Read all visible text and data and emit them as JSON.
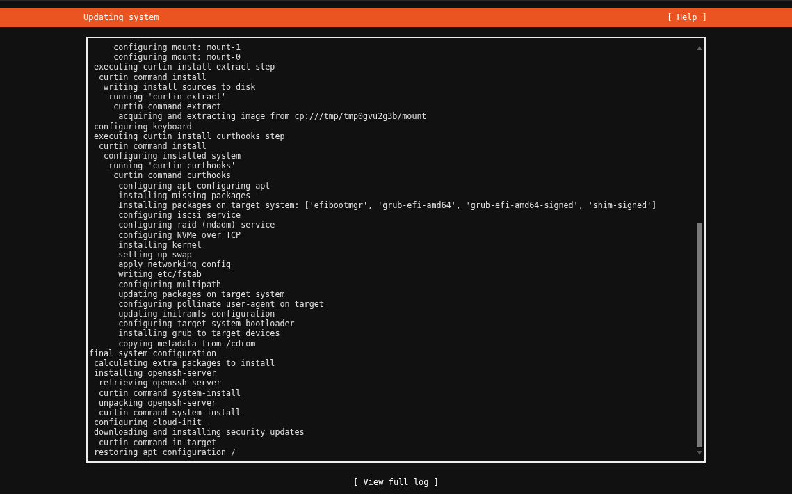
{
  "header": {
    "title": "Updating system",
    "help_button": "[ Help ]"
  },
  "log": {
    "lines": [
      "     configuring mount: mount-1",
      "     configuring mount: mount-0",
      " executing curtin install extract step",
      "  curtin command install",
      "   writing install sources to disk",
      "    running 'curtin extract'",
      "     curtin command extract",
      "      acquiring and extracting image from cp:///tmp/tmp0gvu2g3b/mount",
      " configuring keyboard",
      " executing curtin install curthooks step",
      "  curtin command install",
      "   configuring installed system",
      "    running 'curtin curthooks'",
      "     curtin command curthooks",
      "      configuring apt configuring apt",
      "      installing missing packages",
      "      Installing packages on target system: ['efibootmgr', 'grub-efi-amd64', 'grub-efi-amd64-signed', 'shim-signed']",
      "      configuring iscsi service",
      "      configuring raid (mdadm) service",
      "      configuring NVMe over TCP",
      "      installing kernel",
      "      setting up swap",
      "      apply networking config",
      "      writing etc/fstab",
      "      configuring multipath",
      "      updating packages on target system",
      "      configuring pollinate user-agent on target",
      "      updating initramfs configuration",
      "      configuring target system bootloader",
      "      installing grub to target devices",
      "      copying metadata from /cdrom",
      "final system configuration",
      " calculating extra packages to install",
      " installing openssh-server",
      "  retrieving openssh-server",
      "  curtin command system-install",
      "  unpacking openssh-server",
      "  curtin command system-install",
      " configuring cloud-init",
      " downloading and installing security updates",
      "  curtin command in-target",
      " restoring apt configuration /"
    ]
  },
  "footer": {
    "view_log_button": "[ View full log ]"
  }
}
